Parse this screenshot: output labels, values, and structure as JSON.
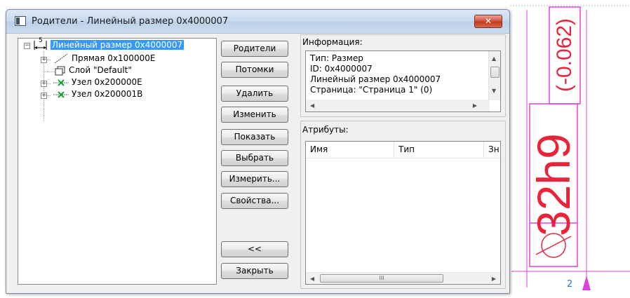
{
  "window": {
    "title": "Родители - Линейный размер 0x4000007",
    "close_label": "✕"
  },
  "tree": {
    "items": [
      {
        "label": "Линейный размер 0x4000007",
        "icon": "linear-dimension-icon",
        "selected": true
      },
      {
        "label": "Прямая 0x100000E",
        "icon": "line-icon"
      },
      {
        "label": "Слой \"Default\"",
        "icon": "layer-icon"
      },
      {
        "label": "Узел 0x200000E",
        "icon": "node-icon"
      },
      {
        "label": "Узел 0x200001B",
        "icon": "node-icon"
      }
    ],
    "dimension_icon_text": "5"
  },
  "buttons": {
    "parents": "Родители",
    "children": "Потомки",
    "delete": "Удалить",
    "edit": "Изменить",
    "show": "Показать",
    "select": "Выбрать",
    "measure": "Измерить...",
    "properties": "Свойства...",
    "collapse": "<<",
    "close": "Закрыть"
  },
  "info": {
    "label": "Информация:",
    "lines": [
      "Тип: Размер",
      "ID: 0x4000007",
      "Линейный размер 0x4000007",
      "Страница: \"Страница 1\" (0)"
    ]
  },
  "attributes": {
    "label": "Атрибуты:",
    "columns": [
      "Имя",
      "Тип",
      "Зн"
    ],
    "scroll_thumb_grip": "III"
  },
  "drawing": {
    "dimension_value": "32h9",
    "tolerance": "(-0.062)",
    "sheet_number": "2",
    "colors": {
      "dimension": "#e8243b",
      "frame": "#e040e0",
      "sheet": "#2a6fd6"
    }
  }
}
